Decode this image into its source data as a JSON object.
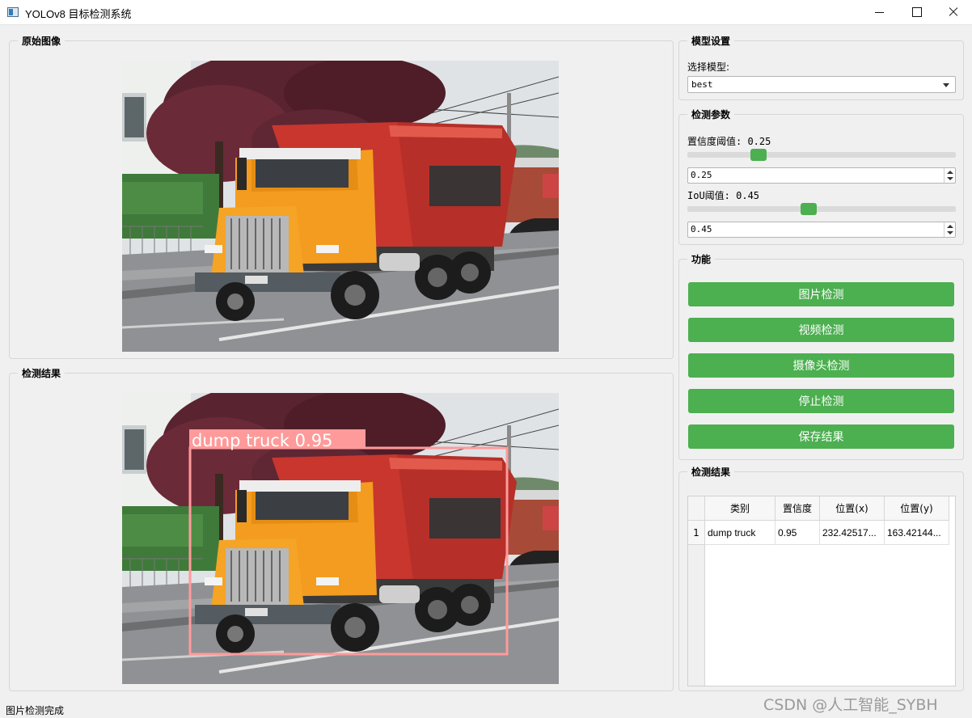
{
  "window": {
    "title": "YOLOv8 目标检测系统"
  },
  "original_panel": {
    "title": "原始图像"
  },
  "result_panel": {
    "title": "检测结果",
    "detection_label": "dump truck 0.95"
  },
  "model_settings": {
    "title": "模型设置",
    "select_label": "选择模型:",
    "selected_model": "best"
  },
  "detection_params": {
    "title": "检测参数",
    "conf_label": "置信度阈值: 0.25",
    "conf_value": "0.25",
    "conf_fraction": 0.25,
    "iou_label": "IoU阈值: 0.45",
    "iou_value": "0.45",
    "iou_fraction": 0.45
  },
  "functions": {
    "title": "功能",
    "buttons": [
      "图片检测",
      "视频检测",
      "摄像头检测",
      "停止检测",
      "保存结果"
    ]
  },
  "results_table": {
    "title": "检测结果",
    "headers": [
      "类别",
      "置信度",
      "位置(x)",
      "位置(y)"
    ],
    "rows": [
      {
        "num": "1",
        "class": "dump truck",
        "conf": "0.95",
        "x": "232.42517...",
        "y": "163.42144..."
      }
    ]
  },
  "status": {
    "text": "图片检测完成"
  },
  "watermark": "CSDN @人工智能_SYBH",
  "colors": {
    "accent": "#4caf50",
    "detection_box": "#ff9a9a"
  }
}
